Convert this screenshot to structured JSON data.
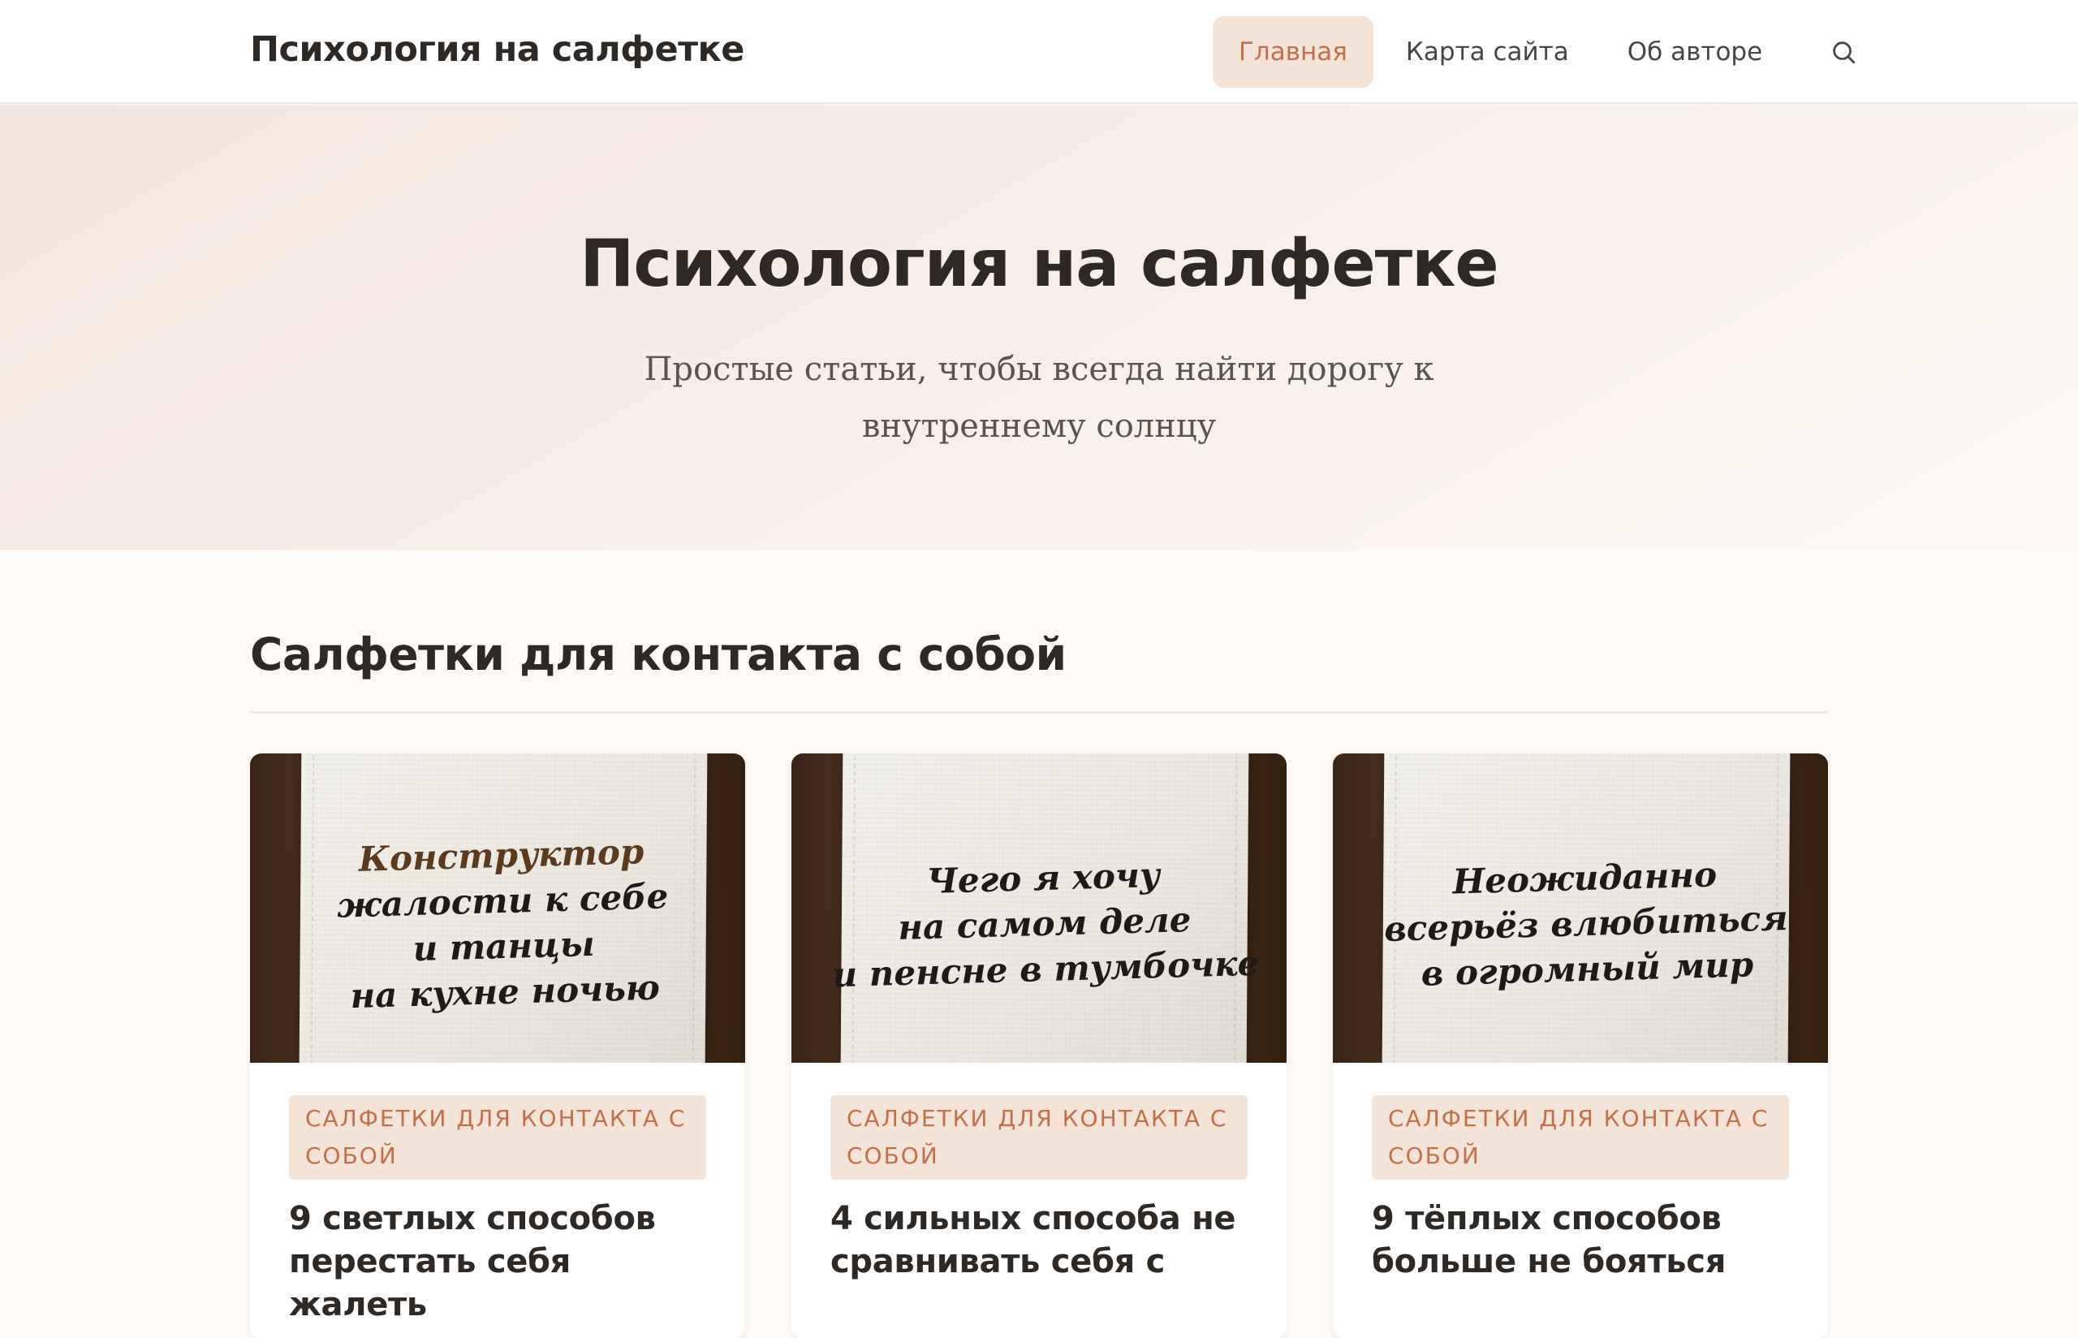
{
  "header": {
    "site_title": "Психология на салфетке",
    "nav": [
      {
        "label": "Главная",
        "active": true
      },
      {
        "label": "Карта сайта",
        "active": false
      },
      {
        "label": "Об авторе",
        "active": false
      }
    ],
    "search_icon": "search-icon"
  },
  "hero": {
    "title": "Психология на салфетке",
    "subtitle": "Простые статьи, чтобы всегда найти дорогу к внутреннему солнцу"
  },
  "section": {
    "title": "Салфетки для контакта с собой"
  },
  "cards": [
    {
      "image_text": [
        "Конструктор",
        "жалости к себе",
        "и танцы",
        "на кухне ночью"
      ],
      "tag": "Салфетки для контакта с собой",
      "title": "9 светлых способов перестать себя жалеть"
    },
    {
      "image_text": [
        "Чего я хочу",
        "на самом деле",
        "и пенсне в тумбочке"
      ],
      "tag": "Салфетки для контакта с собой",
      "title": "4 сильных способа не сравнивать себя с"
    },
    {
      "image_text": [
        "Неожиданно",
        "всерьёз влюбиться",
        "в огромный мир"
      ],
      "tag": "Салфетки для контакта с собой",
      "title": "9 тёплых способов больше не бояться"
    }
  ],
  "colors": {
    "accent": "#c2704a",
    "accent_bg": "#f4e4d8",
    "text": "#2e2925",
    "page_bg": "#fcf9f6"
  }
}
